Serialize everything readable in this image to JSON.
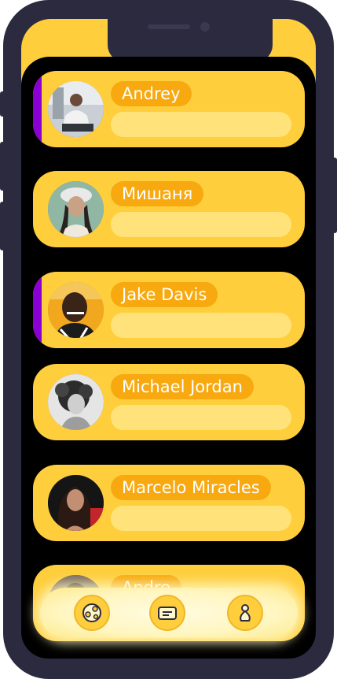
{
  "chats": [
    {
      "name": "Andrey",
      "active": true,
      "avatar_icon": "person-photo"
    },
    {
      "name": "Мишаня",
      "active": false,
      "avatar_icon": "person-photo"
    },
    {
      "name": "Jake Davis",
      "active": true,
      "avatar_icon": "person-photo"
    },
    {
      "name": "Michael Jordan",
      "active": false,
      "avatar_icon": "person-photo"
    },
    {
      "name": "Marcelo Miracles",
      "active": false,
      "avatar_icon": "person-photo"
    },
    {
      "name": "Andre",
      "active": false,
      "avatar_icon": "person-photo"
    }
  ],
  "tabbar": {
    "items": [
      {
        "icon": "globe-icon"
      },
      {
        "icon": "message-card-icon"
      },
      {
        "icon": "profile-icon"
      }
    ]
  },
  "colors": {
    "accent": "#8a00d4",
    "card": "#ffce3d",
    "name_pill": "#f7a90f",
    "message_pill": "#ffe37a",
    "phone_frame": "#2b2a3f"
  }
}
